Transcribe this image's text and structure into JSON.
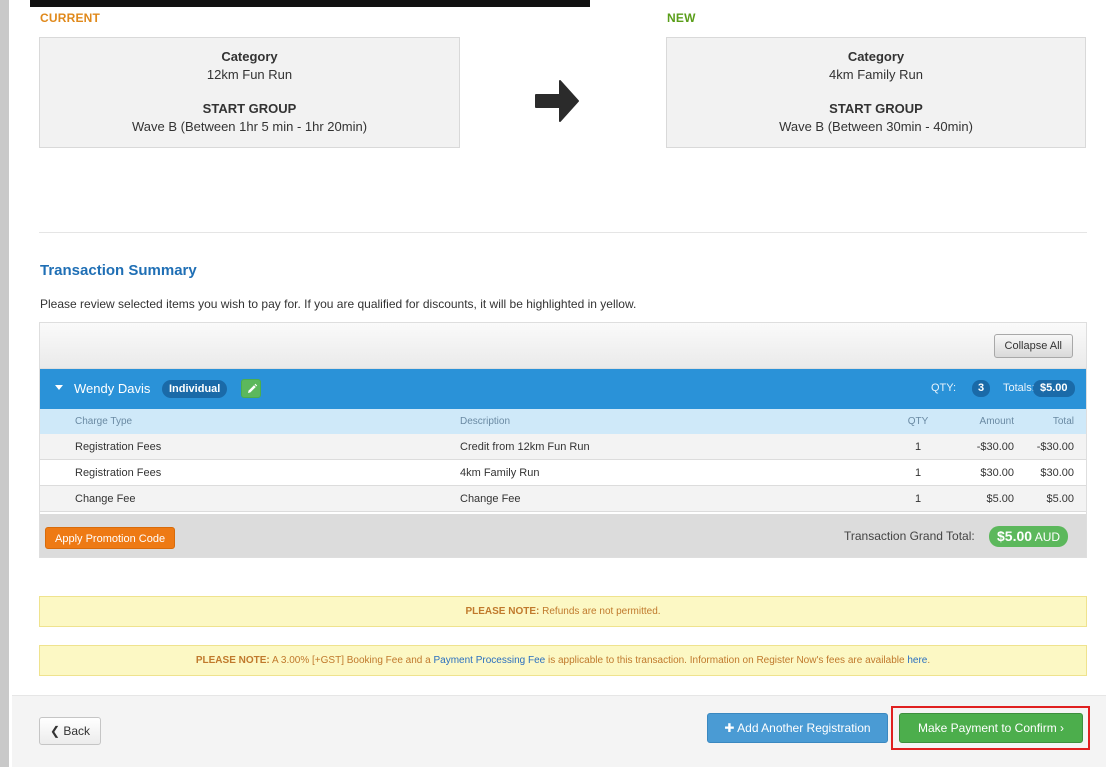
{
  "change": {
    "current_label": "CURRENT",
    "new_label": "NEW",
    "current": {
      "category_heading": "Category",
      "category_value": "12km Fun Run",
      "group_heading": "START GROUP",
      "group_value": "Wave B (Between 1hr 5 min - 1hr 20min)"
    },
    "new": {
      "category_heading": "Category",
      "category_value": "4km Family Run",
      "group_heading": "START GROUP",
      "group_value": "Wave B (Between 30min - 40min)"
    },
    "arrow_icon": "arrow-right-icon"
  },
  "summary": {
    "title": "Transaction Summary",
    "description": "Please review selected items you wish to pay for. If you are qualified for discounts, it will be highlighted in yellow.",
    "collapse_label": "Collapse All",
    "person": {
      "name": "Wendy Davis",
      "type": "Individual",
      "qty_label": "QTY:",
      "qty": "3",
      "totals_label": "Totals:",
      "totals": "$5.00"
    },
    "columns": [
      "Charge Type",
      "Description",
      "QTY",
      "Amount",
      "Total"
    ],
    "rows": [
      {
        "charge_type": "Registration Fees",
        "description": "Credit from 12km Fun Run",
        "qty": "1",
        "amount": "-$30.00",
        "total": "-$30.00"
      },
      {
        "charge_type": "Registration Fees",
        "description": "4km Family Run",
        "qty": "1",
        "amount": "$30.00",
        "total": "$30.00"
      },
      {
        "charge_type": "Change Fee",
        "description": "Change Fee",
        "qty": "1",
        "amount": "$5.00",
        "total": "$5.00"
      }
    ],
    "promo_label": "Apply Promotion Code",
    "grand_total_label": "Transaction Grand Total:",
    "grand_total_value": "$5.00",
    "grand_total_currency": "AUD"
  },
  "notes": {
    "note1_prefix": "PLEASE NOTE:",
    "note1_text": "Refunds are not permitted.",
    "note2_prefix": "PLEASE NOTE:",
    "note2_text_a": "A 3.00% [+GST] Booking Fee and a",
    "note2_link1": "Payment Processing Fee",
    "note2_text_b": "is applicable to this transaction. Information on Register Now's fees are available",
    "note2_link2": "here",
    "note2_text_c": "."
  },
  "footer": {
    "back_label": "Back",
    "add_label": "Add Another Registration",
    "pay_label": "Make Payment to Confirm",
    "pay_suffix": "›"
  },
  "colors": {
    "current_label": "#e0891b",
    "new_label": "#5a9e1a",
    "accent_blue": "#2a92d8",
    "title_blue": "#1f6fb5",
    "success_green": "#5cb85c",
    "promo_orange": "#ee7a14",
    "highlight_red": "#e02020"
  }
}
